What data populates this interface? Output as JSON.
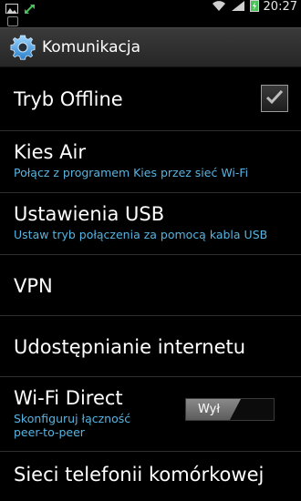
{
  "status_bar": {
    "time": "20:27",
    "icons": [
      "picture-icon",
      "sync-arrow-icon",
      "wifi-icon",
      "signal-icon",
      "battery-icon"
    ]
  },
  "header": {
    "title": "Komunikacja",
    "icon": "gear-icon"
  },
  "settings": [
    {
      "title": "Tryb Offline",
      "checked": true
    },
    {
      "title": "Kies Air",
      "subtitle": "Połącz z programem Kies przez sieć Wi-Fi"
    },
    {
      "title": "Ustawienia USB",
      "subtitle": "Ustaw tryb połączenia za pomocą kabla USB"
    },
    {
      "title": "VPN"
    },
    {
      "title": "Udostępnianie internetu"
    },
    {
      "title": "Wi-Fi Direct",
      "subtitle_line1": "Skonfiguruj łączność",
      "subtitle_line2": "peer-to-peer",
      "toggle_label": "Wył"
    },
    {
      "title": "Sieci telefonii komórkowej"
    }
  ],
  "colors": {
    "accent": "#58b4e2",
    "background": "#000000"
  }
}
